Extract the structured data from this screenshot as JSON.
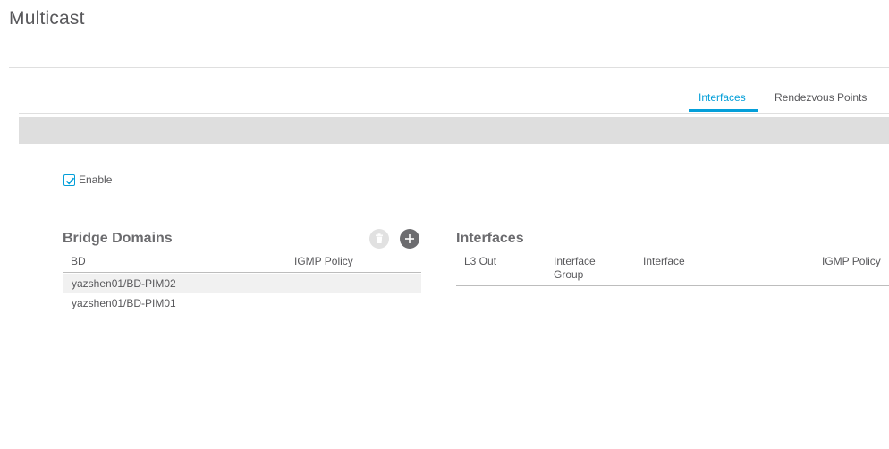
{
  "page": {
    "title": "Multicast"
  },
  "tabs": [
    {
      "label": "Interfaces",
      "active": true
    },
    {
      "label": "Rendezvous Points",
      "active": false
    }
  ],
  "enable": {
    "label": "Enable",
    "checked": true
  },
  "bridge_domains": {
    "title": "Bridge Domains",
    "columns": [
      "BD",
      "IGMP Policy"
    ],
    "rows": [
      {
        "bd": "yazshen01/BD-PIM02",
        "igmp_policy": ""
      },
      {
        "bd": "yazshen01/BD-PIM01",
        "igmp_policy": ""
      }
    ],
    "actions": {
      "delete_icon": "trash-icon",
      "add_icon": "plus-icon"
    }
  },
  "interfaces": {
    "title": "Interfaces",
    "columns": [
      "L3 Out",
      "Interface\nGroup",
      "Interface",
      "IGMP Policy"
    ],
    "rows": []
  },
  "colors": {
    "accent": "#049fd9",
    "band": "#dedede",
    "text": "#58585b"
  }
}
